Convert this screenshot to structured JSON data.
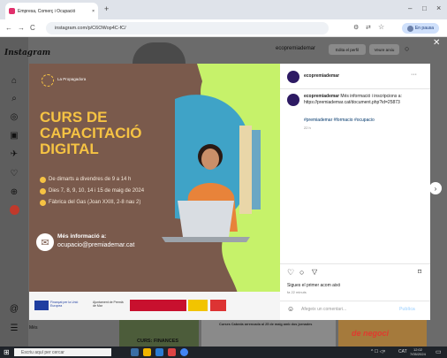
{
  "browser": {
    "tab_title": "Empresa, Comerç i Ocupació",
    "tab_close": "×",
    "new_tab": "+",
    "url": "instagram.com/p/C6OWop4C-fC/",
    "back": "←",
    "forward": "→",
    "reload": "C",
    "profile_label": "En pausa",
    "window_min": "–",
    "window_max": "□",
    "window_close": "×"
  },
  "instagram": {
    "logo": "Instagram",
    "profile_name": "ecopremiademar",
    "edit_profile": "Edita el perfil",
    "view_archive": "Veure arxiu",
    "more_label": "Més",
    "behind_caption": "CURS: FINANCES",
    "behind_title": "Curses Cabeda arrencada al 25 de maig amb dos jornades",
    "behind_right": "de negoci"
  },
  "poster": {
    "brand": "La Propagadora",
    "title_line1": "CURS DE",
    "title_line2": "CAPACITACIÓ",
    "title_line3": "DIGITAL",
    "bullet1": "De dimarts a divendres de 9 a 14 h",
    "bullet2": "Dies 7, 8, 9, 10, 14 i 15 de maig de 2024",
    "bullet3": "Fàbrica del Gas (Joan XXIII, 2-8 nau 2)",
    "info_label": "Més informació a:",
    "info_email": "ocupacio@premiademar.cat",
    "sponsor_eu": "Finançat per la Unió Europea",
    "sponsor_city": "Ajuntament de Premià de Mar"
  },
  "post": {
    "username": "ecopremiademar",
    "caption_user": "ecopremiademar",
    "caption_text": "Més informació i inscripcions a: https://premiademar.cat/document.php?id=25873",
    "hashtags": "#premiademar #formacio #ocupacio",
    "caption_time": "22 h",
    "likes_text": "Sigues el primer acom aixó",
    "post_time": "fa 22 minuts",
    "comment_placeholder": "Afegeix un comentari...",
    "publish_label": "Publica",
    "more_dots": "···"
  },
  "taskbar": {
    "search_placeholder": "Escriu aquí per cercar",
    "lang": "CAT",
    "time": "12:02",
    "date": "7/05/2024"
  },
  "colors": {
    "poster_left": "#7a5a4c",
    "poster_right": "#c6f26a",
    "title_yellow": "#f6c343",
    "ig_accent": "#0095f6"
  }
}
